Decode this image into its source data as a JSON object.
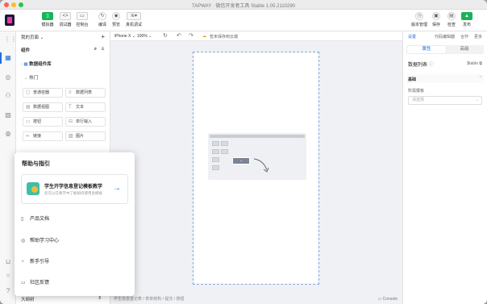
{
  "window": {
    "title": "TAPWAY · 微信开发者工具 Stable 1.05.2110290"
  },
  "toolbar": {
    "left": [
      {
        "icon": "phone-icon",
        "label": "模拟器"
      },
      {
        "icon": "code-icon",
        "label": "调试器"
      },
      {
        "icon": "terminal-icon",
        "label": "控制台"
      },
      {
        "icon": "refresh-icon",
        "label": "编译"
      },
      {
        "icon": "eye-icon",
        "label": "预览"
      },
      {
        "icon": "layers-icon",
        "label": "真机调试"
      }
    ],
    "right": [
      {
        "icon": "history-icon",
        "label": "版本管理"
      },
      {
        "icon": "save-icon",
        "label": "保存"
      },
      {
        "icon": "check-icon",
        "label": "检查"
      },
      {
        "icon": "upload-icon",
        "label": "发布"
      }
    ]
  },
  "left_panel": {
    "page_selector": "我的页面",
    "section_label": "组件",
    "library_title": "数据组件库",
    "group_label": "热门",
    "components": [
      {
        "icon": "container-icon",
        "label": "普通容器"
      },
      {
        "icon": "list-icon",
        "label": "数据列表"
      },
      {
        "icon": "table-icon",
        "label": "数据视图"
      },
      {
        "icon": "text-icon",
        "label": "文本"
      },
      {
        "icon": "button-icon",
        "label": "按钮"
      },
      {
        "icon": "input-icon",
        "label": "单行输入"
      },
      {
        "icon": "link-icon",
        "label": "链接"
      },
      {
        "icon": "image-icon",
        "label": "图片"
      }
    ],
    "outline_label": "大纲树"
  },
  "canvas": {
    "device": "iPhone X",
    "zoom": "100%",
    "auto_save": "暂未保存到云端",
    "placeholder_button": "+",
    "breadcrumb": "学生信息登记表 / 表单结构 / 提交 / 按钮",
    "console_label": "Console"
  },
  "right_panel": {
    "top_tabs": [
      "设置",
      "代码编辑器",
      "合作",
      "更多"
    ],
    "seg_tabs": [
      "属性",
      "高级"
    ],
    "component_name": "数据列表",
    "component_id": "$table",
    "section": "基础",
    "field_label": "所需模板",
    "select_placeholder": "请选择"
  },
  "help": {
    "title": "帮助与指引",
    "card_title": "学生开学信息登记模板教学",
    "card_sub": "您可以在教学中了解如何使用此模板",
    "items": [
      {
        "icon": "doc-icon",
        "label": "产品文档"
      },
      {
        "icon": "globe-icon",
        "label": "帮助学习中心"
      },
      {
        "icon": "compass-icon",
        "label": "新手引导"
      },
      {
        "icon": "chat-icon",
        "label": "社区反馈"
      }
    ]
  },
  "colors": {
    "accent": "#1e6fd9",
    "green": "#19b35b",
    "logo": "#1d1638"
  }
}
